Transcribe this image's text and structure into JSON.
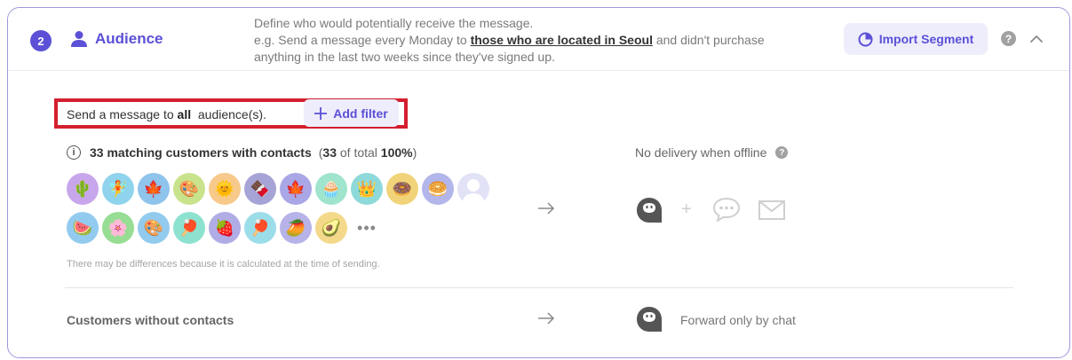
{
  "header": {
    "step_number": "2",
    "title": "Audience",
    "description": {
      "line1": "Define who would potentially receive the message.",
      "line2_prefix": "e.g. Send a message every Monday to ",
      "line2_highlight": "those who are located in Seoul",
      "line2_suffix": " and didn't purchase",
      "line3": "anything in the last two weeks since they've signed up."
    },
    "import_button_label": "Import Segment",
    "help_icon": "?"
  },
  "filter": {
    "prefix": "Send a message to ",
    "emphasis": "all",
    "suffix": "  audience(s).",
    "add_filter_label": "Add filter"
  },
  "matching": {
    "info_icon": "i",
    "count_label": "33 matching customers with contacts",
    "tail_open": "(",
    "tail_count": "33",
    "tail_middle": " of total ",
    "tail_percent": "100%",
    "tail_close": ")"
  },
  "avatars": {
    "row1": [
      {
        "emoji": "🌵",
        "bg": "#c8a6ec"
      },
      {
        "emoji": "🧚",
        "bg": "#8fd3ec"
      },
      {
        "emoji": "🍁",
        "bg": "#8fc4ec"
      },
      {
        "emoji": "🎨",
        "bg": "#c9e38d"
      },
      {
        "emoji": "🌞",
        "bg": "#f7c98b"
      },
      {
        "emoji": "🍫",
        "bg": "#a6a3d6"
      },
      {
        "emoji": "🍁",
        "bg": "#a9a7e6"
      },
      {
        "emoji": "🧁",
        "bg": "#9fe4cc"
      },
      {
        "emoji": "👑",
        "bg": "#8ed9da"
      },
      {
        "emoji": "🍩",
        "bg": "#f1d37a"
      },
      {
        "emoji": "🥯",
        "bg": "#b3b6ea"
      }
    ],
    "row2": [
      {
        "emoji": "🍉",
        "bg": "#93cbef"
      },
      {
        "emoji": "🌸",
        "bg": "#97dd93"
      },
      {
        "emoji": "🎨",
        "bg": "#93cbef"
      },
      {
        "emoji": "🏓",
        "bg": "#8de2cf"
      },
      {
        "emoji": "🍓",
        "bg": "#b0ace5"
      },
      {
        "emoji": "🏓",
        "bg": "#9cddea"
      },
      {
        "emoji": "🥭",
        "bg": "#b7b3e8"
      },
      {
        "emoji": "🥑",
        "bg": "#f4d98b"
      }
    ],
    "more": "•••"
  },
  "note": "There may be differences because it is calculated at the time of sending.",
  "delivery": {
    "offline_label": "No delivery when offline",
    "help_icon": "?",
    "plus": "+"
  },
  "no_contacts": {
    "label": "Customers without contacts",
    "forward_label": "Forward only by chat"
  },
  "colors": {
    "accent": "#5b50d6",
    "accent_bg": "#eeedfb",
    "highlight_border": "#d41f2e",
    "card_border": "#9b98dc"
  }
}
